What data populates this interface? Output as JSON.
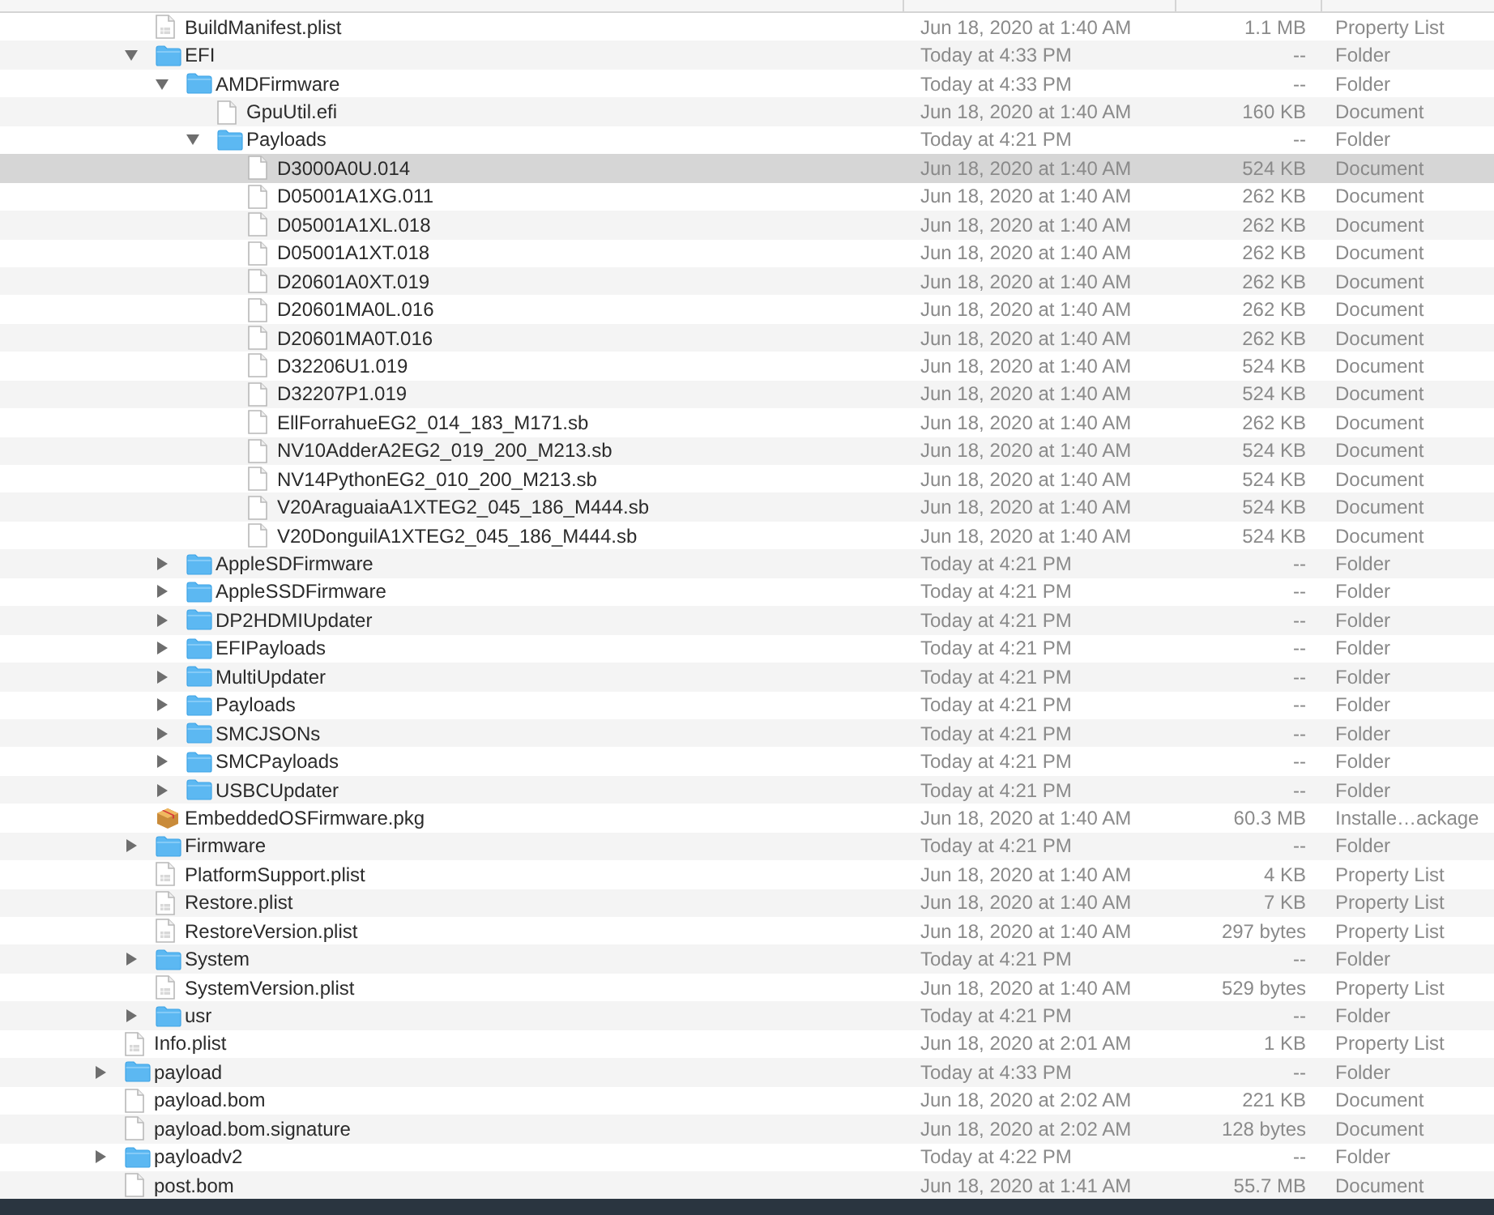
{
  "list": {
    "continued_children": [
      {
        "name": "BuildManifest.plist",
        "kind": "plist",
        "date": "Jun 18, 2020 at 1:40 AM",
        "size": "1.1 MB",
        "file_kind": "Property List",
        "selected": false
      },
      {
        "name": "EFI",
        "kind": "folder",
        "expanded": true,
        "date": "Today at 4:33 PM",
        "size": "--",
        "file_kind": "Folder",
        "selected": false,
        "children": [
          {
            "name": "AMDFirmware",
            "kind": "folder",
            "expanded": true,
            "date": "Today at 4:33 PM",
            "size": "--",
            "file_kind": "Folder",
            "selected": false,
            "children": [
              {
                "name": "GpuUtil.efi",
                "kind": "file",
                "date": "Jun 18, 2020 at 1:40 AM",
                "size": "160 KB",
                "file_kind": "Document",
                "selected": false
              },
              {
                "name": "Payloads",
                "kind": "folder",
                "expanded": true,
                "date": "Today at 4:21 PM",
                "size": "--",
                "file_kind": "Folder",
                "selected": false,
                "children": [
                  {
                    "name": "D3000A0U.014",
                    "kind": "file",
                    "date": "Jun 18, 2020 at 1:40 AM",
                    "size": "524 KB",
                    "file_kind": "Document",
                    "selected": true
                  },
                  {
                    "name": "D05001A1XG.011",
                    "kind": "file",
                    "date": "Jun 18, 2020 at 1:40 AM",
                    "size": "262 KB",
                    "file_kind": "Document",
                    "selected": false
                  },
                  {
                    "name": "D05001A1XL.018",
                    "kind": "file",
                    "date": "Jun 18, 2020 at 1:40 AM",
                    "size": "262 KB",
                    "file_kind": "Document",
                    "selected": false
                  },
                  {
                    "name": "D05001A1XT.018",
                    "kind": "file",
                    "date": "Jun 18, 2020 at 1:40 AM",
                    "size": "262 KB",
                    "file_kind": "Document",
                    "selected": false
                  },
                  {
                    "name": "D20601A0XT.019",
                    "kind": "file",
                    "date": "Jun 18, 2020 at 1:40 AM",
                    "size": "262 KB",
                    "file_kind": "Document",
                    "selected": false
                  },
                  {
                    "name": "D20601MA0L.016",
                    "kind": "file",
                    "date": "Jun 18, 2020 at 1:40 AM",
                    "size": "262 KB",
                    "file_kind": "Document",
                    "selected": false
                  },
                  {
                    "name": "D20601MA0T.016",
                    "kind": "file",
                    "date": "Jun 18, 2020 at 1:40 AM",
                    "size": "262 KB",
                    "file_kind": "Document",
                    "selected": false
                  },
                  {
                    "name": "D32206U1.019",
                    "kind": "file",
                    "date": "Jun 18, 2020 at 1:40 AM",
                    "size": "524 KB",
                    "file_kind": "Document",
                    "selected": false
                  },
                  {
                    "name": "D32207P1.019",
                    "kind": "file",
                    "date": "Jun 18, 2020 at 1:40 AM",
                    "size": "524 KB",
                    "file_kind": "Document",
                    "selected": false
                  },
                  {
                    "name": "EllForrahueEG2_014_183_M171.sb",
                    "kind": "file",
                    "date": "Jun 18, 2020 at 1:40 AM",
                    "size": "262 KB",
                    "file_kind": "Document",
                    "selected": false
                  },
                  {
                    "name": "NV10AdderA2EG2_019_200_M213.sb",
                    "kind": "file",
                    "date": "Jun 18, 2020 at 1:40 AM",
                    "size": "524 KB",
                    "file_kind": "Document",
                    "selected": false
                  },
                  {
                    "name": "NV14PythonEG2_010_200_M213.sb",
                    "kind": "file",
                    "date": "Jun 18, 2020 at 1:40 AM",
                    "size": "524 KB",
                    "file_kind": "Document",
                    "selected": false
                  },
                  {
                    "name": "V20AraguaiaA1XTEG2_045_186_M444.sb",
                    "kind": "file",
                    "date": "Jun 18, 2020 at 1:40 AM",
                    "size": "524 KB",
                    "file_kind": "Document",
                    "selected": false
                  },
                  {
                    "name": "V20DonguilA1XTEG2_045_186_M444.sb",
                    "kind": "file",
                    "date": "Jun 18, 2020 at 1:40 AM",
                    "size": "524 KB",
                    "file_kind": "Document",
                    "selected": false
                  }
                ]
              }
            ]
          },
          {
            "name": "AppleSDFirmware",
            "kind": "folder",
            "expanded": false,
            "date": "Today at 4:21 PM",
            "size": "--",
            "file_kind": "Folder",
            "selected": false
          },
          {
            "name": "AppleSSDFirmware",
            "kind": "folder",
            "expanded": false,
            "date": "Today at 4:21 PM",
            "size": "--",
            "file_kind": "Folder",
            "selected": false
          },
          {
            "name": "DP2HDMIUpdater",
            "kind": "folder",
            "expanded": false,
            "date": "Today at 4:21 PM",
            "size": "--",
            "file_kind": "Folder",
            "selected": false
          },
          {
            "name": "EFIPayloads",
            "kind": "folder",
            "expanded": false,
            "date": "Today at 4:21 PM",
            "size": "--",
            "file_kind": "Folder",
            "selected": false
          },
          {
            "name": "MultiUpdater",
            "kind": "folder",
            "expanded": false,
            "date": "Today at 4:21 PM",
            "size": "--",
            "file_kind": "Folder",
            "selected": false
          },
          {
            "name": "Payloads",
            "kind": "folder",
            "expanded": false,
            "date": "Today at 4:21 PM",
            "size": "--",
            "file_kind": "Folder",
            "selected": false
          },
          {
            "name": "SMCJSONs",
            "kind": "folder",
            "expanded": false,
            "date": "Today at 4:21 PM",
            "size": "--",
            "file_kind": "Folder",
            "selected": false
          },
          {
            "name": "SMCPayloads",
            "kind": "folder",
            "expanded": false,
            "date": "Today at 4:21 PM",
            "size": "--",
            "file_kind": "Folder",
            "selected": false
          },
          {
            "name": "USBCUpdater",
            "kind": "folder",
            "expanded": false,
            "date": "Today at 4:21 PM",
            "size": "--",
            "file_kind": "Folder",
            "selected": false
          }
        ]
      },
      {
        "name": "EmbeddedOSFirmware.pkg",
        "kind": "package",
        "date": "Jun 18, 2020 at 1:40 AM",
        "size": "60.3 MB",
        "file_kind": "Installe…ackage",
        "selected": false
      },
      {
        "name": "Firmware",
        "kind": "folder",
        "expanded": false,
        "date": "Today at 4:21 PM",
        "size": "--",
        "file_kind": "Folder",
        "selected": false
      },
      {
        "name": "PlatformSupport.plist",
        "kind": "plist",
        "date": "Jun 18, 2020 at 1:40 AM",
        "size": "4 KB",
        "file_kind": "Property List",
        "selected": false
      },
      {
        "name": "Restore.plist",
        "kind": "plist",
        "date": "Jun 18, 2020 at 1:40 AM",
        "size": "7 KB",
        "file_kind": "Property List",
        "selected": false
      },
      {
        "name": "RestoreVersion.plist",
        "kind": "plist",
        "date": "Jun 18, 2020 at 1:40 AM",
        "size": "297 bytes",
        "file_kind": "Property List",
        "selected": false
      },
      {
        "name": "System",
        "kind": "folder",
        "expanded": false,
        "date": "Today at 4:21 PM",
        "size": "--",
        "file_kind": "Folder",
        "selected": false
      },
      {
        "name": "SystemVersion.plist",
        "kind": "plist",
        "date": "Jun 18, 2020 at 1:40 AM",
        "size": "529 bytes",
        "file_kind": "Property List",
        "selected": false
      },
      {
        "name": "usr",
        "kind": "folder",
        "expanded": false,
        "date": "Today at 4:21 PM",
        "size": "--",
        "file_kind": "Folder",
        "selected": false
      }
    ],
    "items": [
      {
        "name": "Info.plist",
        "kind": "plist",
        "date": "Jun 18, 2020 at 2:01 AM",
        "size": "1 KB",
        "file_kind": "Property List",
        "selected": false
      },
      {
        "name": "payload",
        "kind": "folder",
        "expanded": false,
        "date": "Today at 4:33 PM",
        "size": "--",
        "file_kind": "Folder",
        "selected": false
      },
      {
        "name": "payload.bom",
        "kind": "file",
        "date": "Jun 18, 2020 at 2:02 AM",
        "size": "221 KB",
        "file_kind": "Document",
        "selected": false
      },
      {
        "name": "payload.bom.signature",
        "kind": "file",
        "date": "Jun 18, 2020 at 2:02 AM",
        "size": "128 bytes",
        "file_kind": "Document",
        "selected": false
      },
      {
        "name": "payloadv2",
        "kind": "folder",
        "expanded": false,
        "date": "Today at 4:22 PM",
        "size": "--",
        "file_kind": "Folder",
        "selected": false
      },
      {
        "name": "post.bom",
        "kind": "file",
        "date": "Jun 18, 2020 at 1:41 AM",
        "size": "55.7 MB",
        "file_kind": "Document",
        "selected": false
      }
    ]
  }
}
